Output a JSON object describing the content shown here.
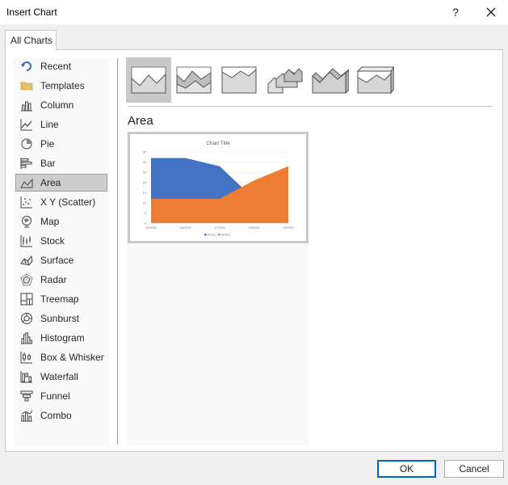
{
  "dialog": {
    "title": "Insert Chart",
    "help_label": "?",
    "tab_label": "All Charts",
    "ok_label": "OK",
    "cancel_label": "Cancel"
  },
  "sidebar": {
    "items": [
      {
        "label": "Recent",
        "icon": "recent-icon"
      },
      {
        "label": "Templates",
        "icon": "folder-icon"
      },
      {
        "label": "Column",
        "icon": "column-chart-icon"
      },
      {
        "label": "Line",
        "icon": "line-chart-icon"
      },
      {
        "label": "Pie",
        "icon": "pie-chart-icon"
      },
      {
        "label": "Bar",
        "icon": "bar-chart-icon"
      },
      {
        "label": "Area",
        "icon": "area-chart-icon",
        "selected": true
      },
      {
        "label": "X Y (Scatter)",
        "icon": "scatter-chart-icon"
      },
      {
        "label": "Map",
        "icon": "map-chart-icon"
      },
      {
        "label": "Stock",
        "icon": "stock-chart-icon"
      },
      {
        "label": "Surface",
        "icon": "surface-chart-icon"
      },
      {
        "label": "Radar",
        "icon": "radar-chart-icon"
      },
      {
        "label": "Treemap",
        "icon": "treemap-chart-icon"
      },
      {
        "label": "Sunburst",
        "icon": "sunburst-chart-icon"
      },
      {
        "label": "Histogram",
        "icon": "histogram-chart-icon"
      },
      {
        "label": "Box & Whisker",
        "icon": "box-whisker-chart-icon"
      },
      {
        "label": "Waterfall",
        "icon": "waterfall-chart-icon"
      },
      {
        "label": "Funnel",
        "icon": "funnel-chart-icon"
      },
      {
        "label": "Combo",
        "icon": "combo-chart-icon"
      }
    ]
  },
  "subtypes": [
    {
      "icon": "area-icon",
      "selected": true
    },
    {
      "icon": "stacked-area-icon"
    },
    {
      "icon": "100-stacked-area-icon"
    },
    {
      "icon": "3d-area-icon"
    },
    {
      "icon": "3d-stacked-area-icon"
    },
    {
      "icon": "3d-100-stacked-area-icon"
    }
  ],
  "main": {
    "section_title": "Area"
  },
  "colors": {
    "series1": "#4472c4",
    "series2": "#ed7d31",
    "selection": "#cdcdcd",
    "ok_border": "#0067c0"
  },
  "chart_data": {
    "type": "area",
    "title": "Chart Title",
    "categories": [
      "1/5/2002",
      "1/6/2002",
      "1/7/2002",
      "1/8/2002",
      "1/9/2002"
    ],
    "series": [
      {
        "name": "Series1",
        "values": [
          32,
          32,
          28,
          12,
          12
        ]
      },
      {
        "name": "Series2",
        "values": [
          12,
          12,
          12,
          21,
          28
        ]
      }
    ],
    "yticks": [
      0,
      5,
      10,
      15,
      20,
      25,
      30,
      35
    ],
    "ylim": [
      0,
      35
    ],
    "grid": true,
    "legend": "bottom"
  }
}
